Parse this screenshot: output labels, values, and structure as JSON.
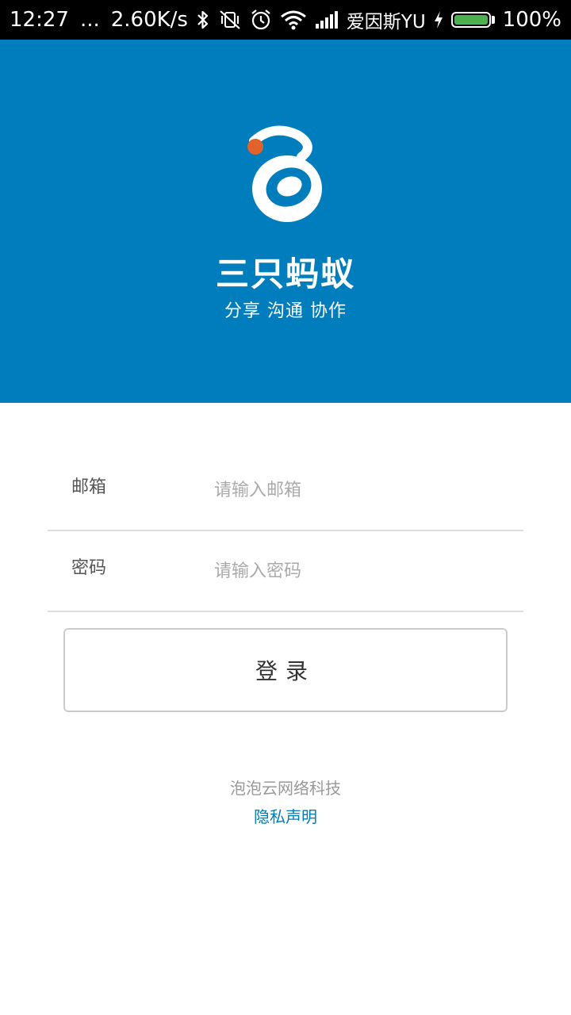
{
  "status_bar": {
    "time": "12:27",
    "dots": "...",
    "net_speed": "2.60K/s",
    "carrier": "爱因斯YU",
    "battery": "100%",
    "battery_fill_percent": 100,
    "battery_color": "#4caf50",
    "icons": [
      "bluetooth-icon",
      "vibrate-off-icon",
      "alarm-icon",
      "wifi-icon",
      "signal-icon",
      "charging-icon",
      "battery-icon"
    ]
  },
  "header": {
    "background": "#007dbd",
    "logo_accent": "#e2622b",
    "app_name": "三只蚂蚁",
    "slogan": "分享 沟通 协作"
  },
  "form": {
    "email_label": "邮箱",
    "email_placeholder": "请输入邮箱",
    "email_value": "",
    "password_label": "密码",
    "password_placeholder": "请输入密码",
    "password_value": "",
    "login_label": "登录"
  },
  "footer": {
    "company": "泡泡云网络科技",
    "privacy_link": "隐私声明"
  }
}
